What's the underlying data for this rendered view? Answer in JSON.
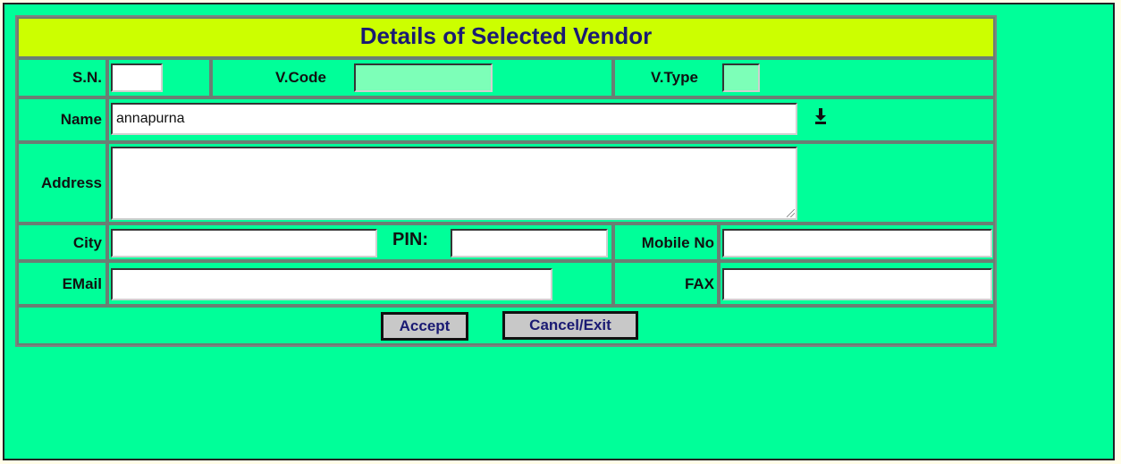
{
  "form": {
    "title": "Details of Selected Vendor",
    "labels": {
      "sn": "S.N.",
      "vcode": "V.Code",
      "vtype": "V.Type",
      "name": "Name",
      "address": "Address",
      "city": "City",
      "pin": "PIN:",
      "mobile": "Mobile No",
      "email": "EMail",
      "fax": "FAX"
    },
    "values": {
      "sn": "",
      "vcode": "",
      "vtype": "",
      "name": "annapurna",
      "address": "",
      "city": "",
      "pin": "",
      "mobile": "",
      "email": "",
      "fax": ""
    },
    "buttons": {
      "accept": "Accept",
      "cancel": "Cancel/Exit"
    },
    "colors": {
      "panel_bg": "#00ff99",
      "title_bg": "#ccff00",
      "title_text": "#1a1a73",
      "readonly_input": "#7dffb8"
    },
    "icons": {
      "name_dropdown": "download-arrow-icon"
    }
  }
}
